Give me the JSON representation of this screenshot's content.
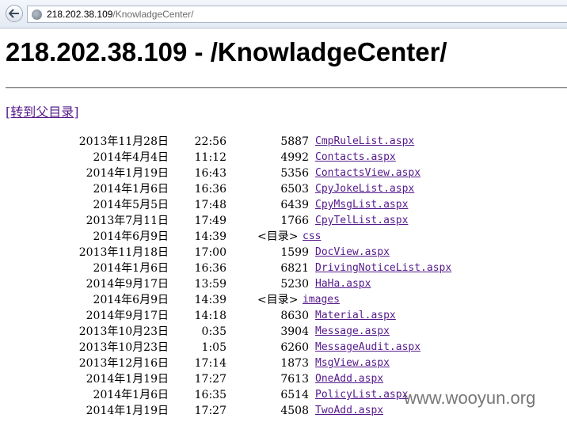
{
  "browser": {
    "url_host": "218.202.38.109",
    "url_path": "/KnowladgeCenter/"
  },
  "page": {
    "title": "218.202.38.109 - /KnowladgeCenter/",
    "parent_link": "[转到父目录]"
  },
  "listing": [
    {
      "date": "2013年11月28日",
      "time": "22:56",
      "size": "5887",
      "name": "CmpRuleList.aspx"
    },
    {
      "date": "2014年4月4日",
      "time": "11:12",
      "size": "4992",
      "name": "Contacts.aspx"
    },
    {
      "date": "2014年1月19日",
      "time": "16:43",
      "size": "5356",
      "name": "ContactsView.aspx"
    },
    {
      "date": "2014年1月6日",
      "time": "16:36",
      "size": "6503",
      "name": "CpyJokeList.aspx"
    },
    {
      "date": "2014年5月5日",
      "time": "17:48",
      "size": "6439",
      "name": "CpyMsgList.aspx"
    },
    {
      "date": "2013年7月11日",
      "time": "17:49",
      "size": "1766",
      "name": "CpyTelList.aspx"
    },
    {
      "date": "2014年6月9日",
      "time": "14:39",
      "dir_label": "<目录>",
      "name": "css"
    },
    {
      "date": "2013年11月18日",
      "time": "17:00",
      "size": "1599",
      "name": "DocView.aspx"
    },
    {
      "date": "2014年1月6日",
      "time": "16:36",
      "size": "6821",
      "name": "DrivingNoticeList.aspx"
    },
    {
      "date": "2014年9月17日",
      "time": "13:59",
      "size": "5230",
      "name": "HaHa.aspx"
    },
    {
      "date": "2014年6月9日",
      "time": "14:39",
      "dir_label": "<目录>",
      "name": "images"
    },
    {
      "date": "2014年9月17日",
      "time": "14:18",
      "size": "8630",
      "name": "Material.aspx"
    },
    {
      "date": "2013年10月23日",
      "time": "0:35",
      "size": "3904",
      "name": "Message.aspx"
    },
    {
      "date": "2013年10月23日",
      "time": "1:05",
      "size": "6260",
      "name": "MessageAudit.aspx"
    },
    {
      "date": "2013年12月16日",
      "time": "17:14",
      "size": "1873",
      "name": "MsgView.aspx"
    },
    {
      "date": "2014年1月19日",
      "time": "17:27",
      "size": "7613",
      "name": "OneAdd.aspx"
    },
    {
      "date": "2014年1月6日",
      "time": "16:35",
      "size": "6514",
      "name": "PolicyList.aspx"
    },
    {
      "date": "2014年1月19日",
      "time": "17:27",
      "size": "4508",
      "name": "TwoAdd.aspx"
    }
  ],
  "watermark": "www.wooyun.org"
}
